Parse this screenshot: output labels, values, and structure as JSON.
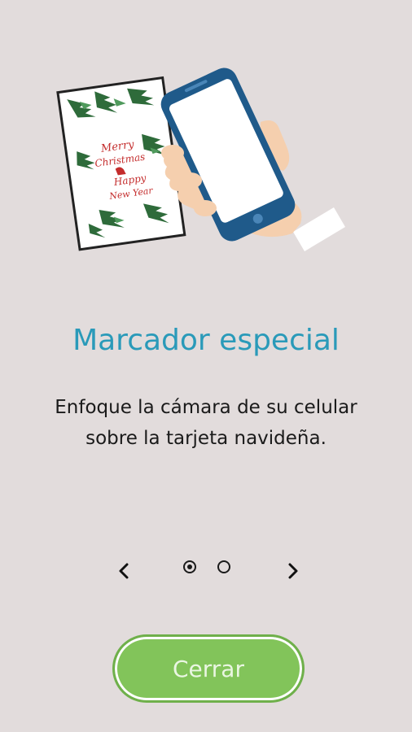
{
  "onboarding": {
    "title": "Marcador especial",
    "description": "Enfoque la cámara de su celular sobre la tarjeta navideña.",
    "close_label": "Cerrar",
    "page_indicator": {
      "current": 1,
      "total": 2
    },
    "illustration": {
      "card_text": [
        "Merry",
        "Christmas",
        "Happy",
        "New Year"
      ]
    }
  },
  "colors": {
    "background": "#e2dcdc",
    "title": "#2a9ab9",
    "button": "#82c45a",
    "phone_frame": "#1f5a8a"
  }
}
